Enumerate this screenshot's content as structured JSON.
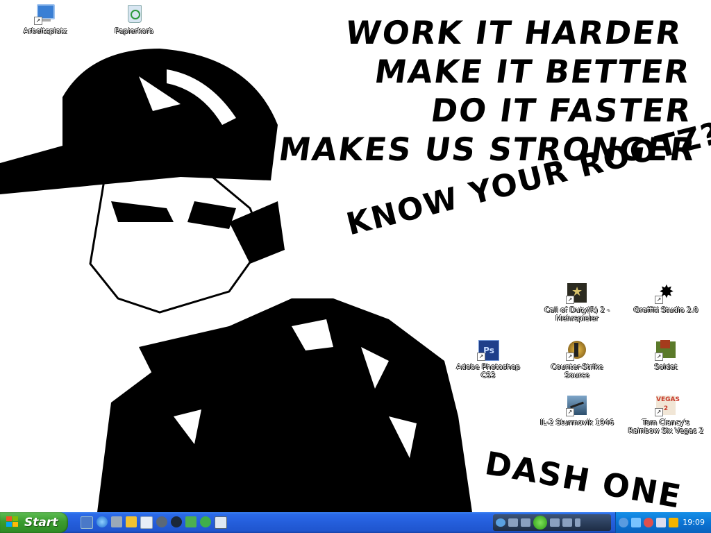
{
  "wallpaper": {
    "lines": [
      "WORK IT HARDER",
      "MAKE IT BETTER",
      "DO IT FASTER",
      "MAKES US STRONGER",
      "KNOW YOUR ROOTZ?!",
      "DASH ONE"
    ]
  },
  "desktop_icons": [
    {
      "label": "Arbeitsplatz",
      "icon": "computer-icon"
    },
    {
      "label": "Papierkorb",
      "icon": "recycle-bin-icon"
    },
    {
      "label": "Call of Duty(R) 2 - Mehrspieler",
      "icon": "call-of-duty-icon"
    },
    {
      "label": "Graffiti Studio 2.0",
      "icon": "graffiti-studio-icon"
    },
    {
      "label": "Adobe Photoshop CS3",
      "icon": "photoshop-icon",
      "badge": "Ps"
    },
    {
      "label": "Counter-Strike Source",
      "icon": "counter-strike-icon"
    },
    {
      "label": "Soldat",
      "icon": "soldat-icon"
    },
    {
      "label": "IL-2 Sturmovik 1946",
      "icon": "il2-icon"
    },
    {
      "label": "Tom Clancy's Rainbow Six Vegas 2",
      "icon": "rainbow-six-icon",
      "badge": "VEGAS 2"
    }
  ],
  "taskbar": {
    "start_label": "Start",
    "clock": "19:09",
    "quick_launch": [
      "show-desktop-icon",
      "internet-explorer-icon",
      "network-icon",
      "app-icon",
      "app-icon",
      "headset-icon",
      "steam-icon",
      "puzzle-icon",
      "messenger-icon",
      "window-icon"
    ],
    "tray": [
      "collapse-arrow-icon",
      "network-icon",
      "users-icon",
      "monitor-icon",
      "pen-icon"
    ]
  },
  "colors": {
    "taskbar": "#245edb",
    "start": "#3b9c2f",
    "tray": "#0b74d4"
  }
}
